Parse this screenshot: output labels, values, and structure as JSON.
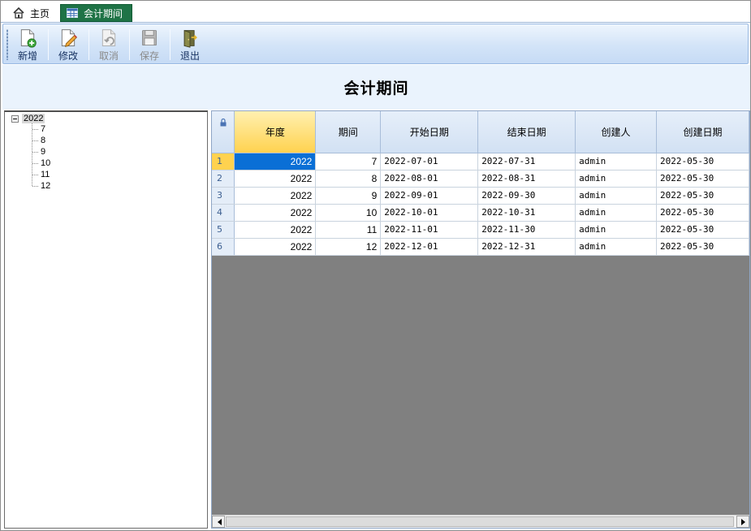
{
  "tabs": [
    {
      "label": "主页",
      "icon": "home-icon"
    },
    {
      "label": "会计期间",
      "icon": "table-icon"
    }
  ],
  "toolbar": {
    "add_label": "新增",
    "edit_label": "修改",
    "cancel_label": "取消",
    "save_label": "保存",
    "exit_label": "退出"
  },
  "page": {
    "title": "会计期间"
  },
  "tree": {
    "root": "2022",
    "children": [
      "7",
      "8",
      "9",
      "10",
      "11",
      "12"
    ]
  },
  "grid": {
    "columns": [
      "年度",
      "期间",
      "开始日期",
      "结束日期",
      "创建人",
      "创建日期"
    ],
    "rows": [
      {
        "num": "1",
        "year": "2022",
        "period": "7",
        "start": "2022-07-01",
        "end": "2022-07-31",
        "creator": "admin",
        "created": "2022-05-30"
      },
      {
        "num": "2",
        "year": "2022",
        "period": "8",
        "start": "2022-08-01",
        "end": "2022-08-31",
        "creator": "admin",
        "created": "2022-05-30"
      },
      {
        "num": "3",
        "year": "2022",
        "period": "9",
        "start": "2022-09-01",
        "end": "2022-09-30",
        "creator": "admin",
        "created": "2022-05-30"
      },
      {
        "num": "4",
        "year": "2022",
        "period": "10",
        "start": "2022-10-01",
        "end": "2022-10-31",
        "creator": "admin",
        "created": "2022-05-30"
      },
      {
        "num": "5",
        "year": "2022",
        "period": "11",
        "start": "2022-11-01",
        "end": "2022-11-30",
        "creator": "admin",
        "created": "2022-05-30"
      },
      {
        "num": "6",
        "year": "2022",
        "period": "12",
        "start": "2022-12-01",
        "end": "2022-12-31",
        "creator": "admin",
        "created": "2022-05-30"
      }
    ]
  },
  "colors": {
    "active_tab": "#1f7346",
    "selected_cell": "#0a6fd6",
    "sorted_header": "#ffd24f",
    "empty_grid": "#808080"
  }
}
